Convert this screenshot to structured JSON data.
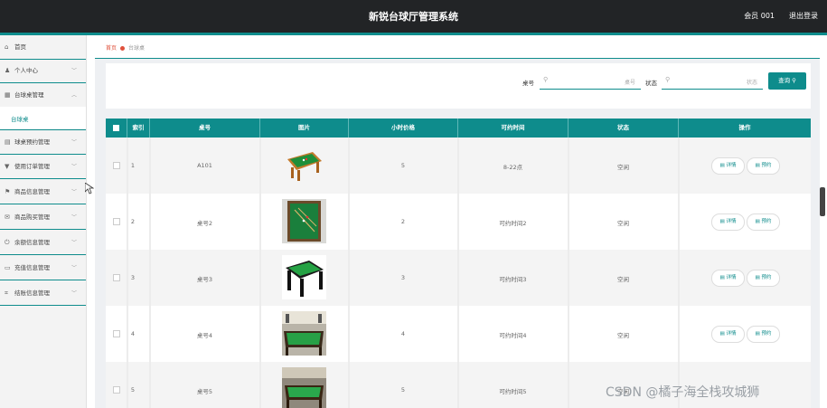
{
  "header": {
    "title": "新锐台球厅管理系统",
    "user": "会员 001",
    "logout": "退出登录"
  },
  "sidebar": {
    "items": [
      {
        "label": "首页",
        "icon": "home-icon",
        "glyph": "⌂",
        "expandable": false
      },
      {
        "label": "个人中心",
        "icon": "user-icon",
        "glyph": "♟",
        "expandable": true
      },
      {
        "label": "台球桌管理",
        "icon": "grid-icon",
        "glyph": "▦",
        "expandable": true,
        "expanded": true,
        "children": [
          "台球桌"
        ]
      },
      {
        "label": "球桌预约管理",
        "icon": "clipboard-icon",
        "glyph": "▤",
        "expandable": true
      },
      {
        "label": "使用订单管理",
        "icon": "tag-icon",
        "glyph": "▼",
        "expandable": true
      },
      {
        "label": "商品信息管理",
        "icon": "flag-icon",
        "glyph": "⚑",
        "expandable": true
      },
      {
        "label": "商品购买管理",
        "icon": "mail-icon",
        "glyph": "✉",
        "expandable": true
      },
      {
        "label": "余额信息管理",
        "icon": "power-icon",
        "glyph": "⏻",
        "expandable": true
      },
      {
        "label": "充值信息管理",
        "icon": "card-icon",
        "glyph": "▭",
        "expandable": true
      },
      {
        "label": "结账信息管理",
        "icon": "crop-icon",
        "glyph": "⌗",
        "expandable": true
      }
    ]
  },
  "breadcrumb": {
    "home": "首页",
    "current": "台球桌"
  },
  "search": {
    "table_no_label": "桌号",
    "table_no_placeholder": "桌号",
    "status_label": "状态",
    "status_placeholder": "状态",
    "button": "查询"
  },
  "table": {
    "columns": [
      "索引",
      "桌号",
      "图片",
      "小时价格",
      "可约时间",
      "状态",
      "操作"
    ],
    "rows": [
      {
        "index": "1",
        "table_no": "A101",
        "price": "5",
        "time": "8-22点",
        "status": "空闲"
      },
      {
        "index": "2",
        "table_no": "桌号2",
        "price": "2",
        "time": "可约时间2",
        "status": "空闲"
      },
      {
        "index": "3",
        "table_no": "桌号3",
        "price": "3",
        "time": "可约时间3",
        "status": "空闲"
      },
      {
        "index": "4",
        "table_no": "桌号4",
        "price": "4",
        "time": "可约时间4",
        "status": "空闲"
      },
      {
        "index": "5",
        "table_no": "桌号5",
        "price": "5",
        "time": "可约时间5",
        "status": "空闲"
      }
    ],
    "actions": {
      "detail": "详情",
      "reserve": "预约"
    }
  },
  "watermark": "CSDN @橘子海全栈攻城狮",
  "colors": {
    "accent": "#0e8c8c",
    "topbar": "#222426",
    "crumb": "#e0513c"
  }
}
